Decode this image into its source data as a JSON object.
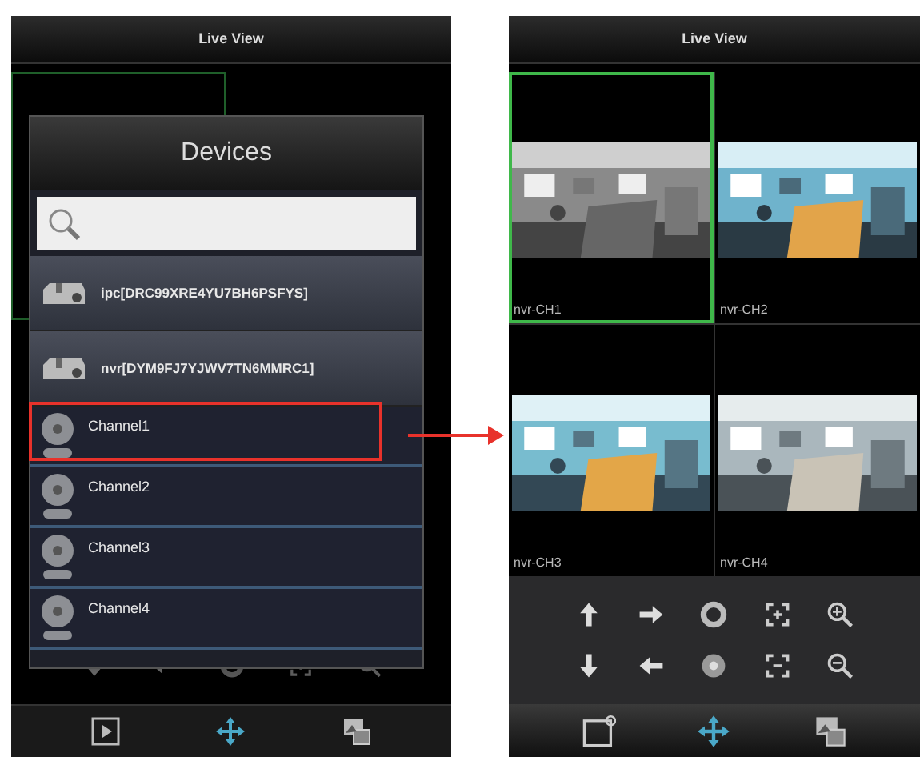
{
  "left_screen": {
    "title": "Live View",
    "dialog": {
      "title": "Devices",
      "items": [
        {
          "kind": "device",
          "label": "ipc[DRC99XRE4YU7BH6PSFYS]",
          "highlighted": false
        },
        {
          "kind": "device",
          "label": "nvr[DYM9FJ7YJWV7TN6MMRC1]",
          "highlighted": false
        },
        {
          "kind": "channel",
          "label": "Channel1",
          "highlighted": true
        },
        {
          "kind": "channel",
          "label": "Channel2",
          "highlighted": false
        },
        {
          "kind": "channel",
          "label": "Channel3",
          "highlighted": false
        },
        {
          "kind": "channel",
          "label": "Channel4",
          "highlighted": false
        }
      ]
    }
  },
  "right_screen": {
    "title": "Live View",
    "cells": [
      {
        "label": "nvr-CH1",
        "selected": true,
        "kind": "picture"
      },
      {
        "label": "nvr-CH2",
        "selected": false,
        "kind": "picture"
      },
      {
        "label": "nvr-CH3",
        "selected": false,
        "kind": "picture"
      },
      {
        "label": "nvr-CH4",
        "selected": false,
        "kind": "picture"
      }
    ]
  }
}
